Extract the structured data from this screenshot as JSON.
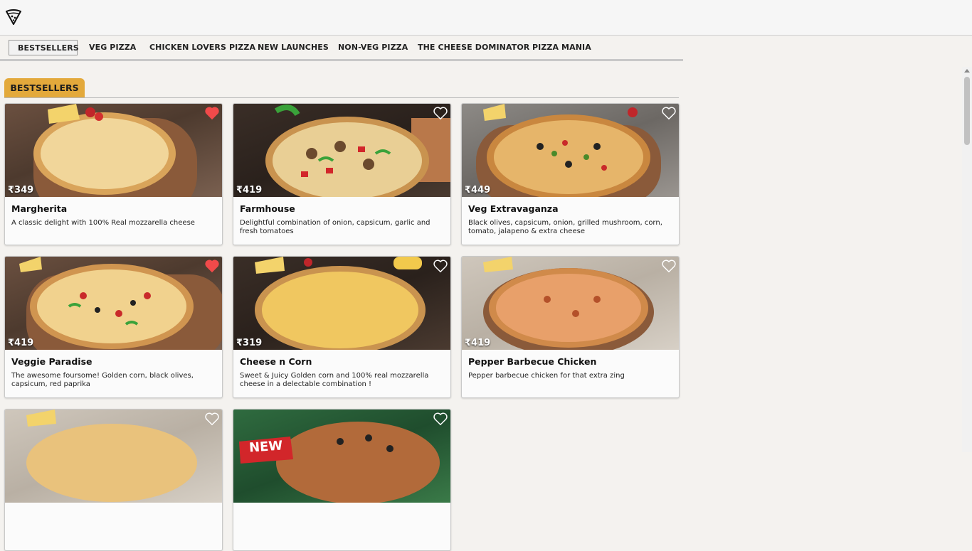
{
  "brand": {
    "logo_icon": "pizza-slice-icon"
  },
  "tabs": [
    {
      "label": "BESTSELLERS",
      "active": true
    },
    {
      "label": "VEG PIZZA"
    },
    {
      "label": "CHICKEN LOVERS PIZZA"
    },
    {
      "label": "NEW LAUNCHES"
    },
    {
      "label": "NON-VEG PIZZA"
    },
    {
      "label": "THE CHEESE DOMINATOR"
    },
    {
      "label": "PIZZA MANIA"
    }
  ],
  "section": {
    "title": "BESTSELLERS",
    "accent": "#e3a93b"
  },
  "products": [
    {
      "name": "Margherita",
      "price": "₹349",
      "description": "A classic delight with 100% Real mozzarella cheese",
      "favorite": true
    },
    {
      "name": "Farmhouse",
      "price": "₹419",
      "description": "Delightful combination of onion, capsicum, garlic and fresh tomatoes",
      "favorite": false
    },
    {
      "name": "Veg Extravaganza",
      "price": "₹449",
      "description": "Black olives, capsicum, onion, grilled mushroom, corn, tomato, jalapeno & extra cheese",
      "favorite": false
    },
    {
      "name": "Veggie Paradise",
      "price": "₹419",
      "description": "The awesome foursome! Golden corn, black olives, capsicum, red paprika",
      "favorite": true
    },
    {
      "name": "Cheese n Corn",
      "price": "₹319",
      "description": "Sweet & Juicy Golden corn and 100% real mozzarella cheese in a delectable combination !",
      "favorite": false
    },
    {
      "name": "Pepper Barbecue Chicken",
      "price": "₹419",
      "description": "Pepper barbecue chicken for that extra zing",
      "favorite": false
    },
    {
      "favorite": false
    },
    {
      "badge": "NEW",
      "favorite": false
    }
  ],
  "colors": {
    "favorite_active": "#f04a4a",
    "heart_outline": "#ffffff"
  }
}
